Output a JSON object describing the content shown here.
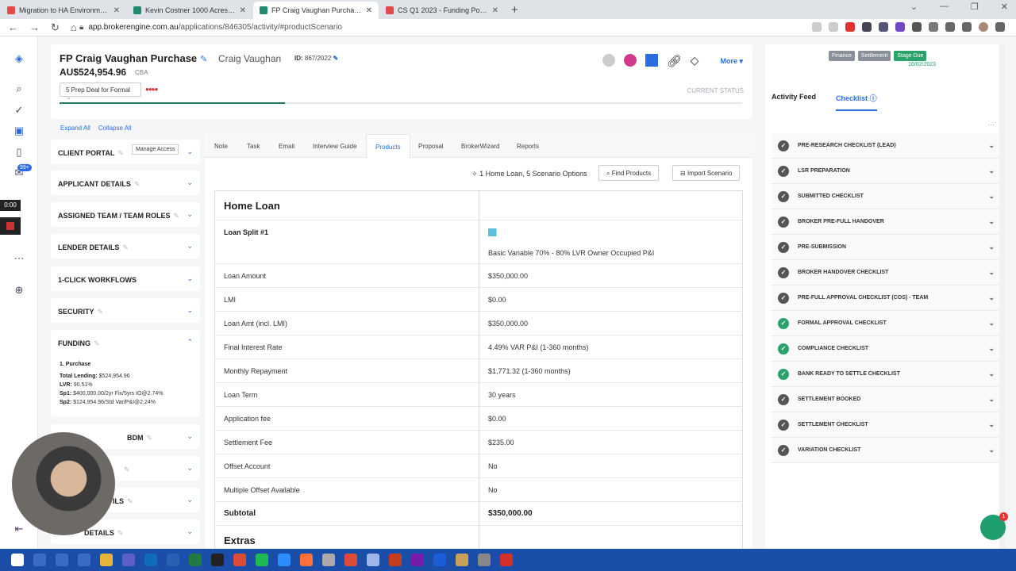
{
  "browser": {
    "tabs": [
      {
        "title": "Migration to HA Environment",
        "color": "#e24a4a",
        "active": false
      },
      {
        "title": "Kevin Costner 1000 Acres Purcha...",
        "color": "#1f8a70",
        "active": false
      },
      {
        "title": "FP Craig Vaughan Purchase | Bro...",
        "color": "#1f8a70",
        "active": true
      },
      {
        "title": "CS Q1 2023 - Funding Position",
        "color": "#e24a4a",
        "active": false
      }
    ],
    "url_host": "app.brokerengine.com.au",
    "url_path": "/applications/846305/activity/#productScenario"
  },
  "rail": {
    "badge": "99+",
    "timer": "0:00"
  },
  "header": {
    "title": "FP Craig Vaughan Purchase",
    "client": "Craig Vaughan",
    "id_label": "ID:",
    "id_value": "867/2022",
    "amount": "AU$524,954.96",
    "lender": "CBA",
    "status": "5 Prep Deal for Formal",
    "current_status": "CURRENT STATUS",
    "more": "More",
    "progress": 0.33
  },
  "expand": {
    "expand_all": "Expand All",
    "collapse_all": "Collapse All"
  },
  "sections": {
    "client_portal": "CLIENT PORTAL",
    "manage_access": "Manage Access",
    "applicant": "APPLICANT DETAILS",
    "team": "ASSIGNED TEAM / TEAM ROLES",
    "lender": "LENDER DETAILS",
    "workflows": "1-CLICK WORKFLOWS",
    "security": "SECURITY",
    "funding": "FUNDING",
    "bdm": "BDM",
    "details1": "ILS",
    "details2": "DETAILS"
  },
  "funding": {
    "heading": "1. Purchase",
    "total_label": "Total Lending:",
    "total": "$524,954.96",
    "lvr_label": "LVR:",
    "lvr": "90.51%",
    "sp1_label": "Sp1:",
    "sp1": "$400,000.00/2yr Fix/5yrs IO@2.74%",
    "sp2_label": "Sp2:",
    "sp2": "$124,954.96/Std Var/P&I@2.24%"
  },
  "main": {
    "tabs": [
      "Note",
      "Task",
      "Email",
      "Interview Guide",
      "Products",
      "Proposal",
      "BrokerWizard",
      "Reports"
    ],
    "active_tab": "Products",
    "scenario": "1 Home Loan, 5 Scenario Options",
    "find_products": "Find Products",
    "import_scenario": "Import Scenario",
    "section_title": "Home Loan",
    "split_label": "Loan Split #1",
    "product": "Basic Variable 70% - 80% LVR Owner Occupied P&I",
    "rows": [
      {
        "label": "Loan Amount",
        "value": "$350,000.00"
      },
      {
        "label": "LMI",
        "value": "$0.00"
      },
      {
        "label": "Loan Amt (incl. LMI)",
        "value": "$350,000.00"
      },
      {
        "label": "Final Interest Rate",
        "value": "4.49% VAR P&I (1-360 months)"
      },
      {
        "label": "Monthly Repayment",
        "value": "$1,771.32 (1-360 months)"
      },
      {
        "label": "Loan Term",
        "value": "30 years"
      },
      {
        "label": "Application fee",
        "value": "$0.00"
      },
      {
        "label": "Settlement Fee",
        "value": "$235.00"
      },
      {
        "label": "Offset Account",
        "value": "No"
      },
      {
        "label": "Multiple Offset Available",
        "value": "No"
      }
    ],
    "subtotal_label": "Subtotal",
    "subtotal": "$350,000.00",
    "extras": "Extras"
  },
  "right": {
    "stages": [
      {
        "label": "Finance",
        "color": "#8a9099"
      },
      {
        "label": "Settlement",
        "color": "#8a9099"
      },
      {
        "label": "Stage Due",
        "color": "#2aa36b"
      }
    ],
    "stage_date": "16/02/2023",
    "tab_activity": "Activity Feed",
    "tab_checklist": "Checklist",
    "checklists": [
      {
        "label": "PRE-RESEARCH CHECKLIST (LEAD)",
        "done": false
      },
      {
        "label": "LSR PREPARATION",
        "done": false
      },
      {
        "label": "SUBMITTED CHECKLIST",
        "done": false
      },
      {
        "label": "BROKER PRE-FULL HANDOVER",
        "done": false
      },
      {
        "label": "PRE-SUBMISSION",
        "done": false
      },
      {
        "label": "BROKER HANDOVER CHECKLIST",
        "done": false
      },
      {
        "label": "PRE-FULL APPROVAL CHECKLIST (COS) - TEAM",
        "done": false
      },
      {
        "label": "FORMAL APPROVAL CHECKLIST",
        "done": true
      },
      {
        "label": "COMPLIANCE CHECKLIST",
        "done": true
      },
      {
        "label": "BANK READY TO SETTLE CHECKLIST",
        "done": true
      },
      {
        "label": "SETTLEMENT BOOKED",
        "done": false
      },
      {
        "label": "SETTLEMENT CHECKLIST",
        "done": false
      },
      {
        "label": "VARIATION CHECKLIST",
        "done": false
      }
    ]
  },
  "chat_count": "1"
}
